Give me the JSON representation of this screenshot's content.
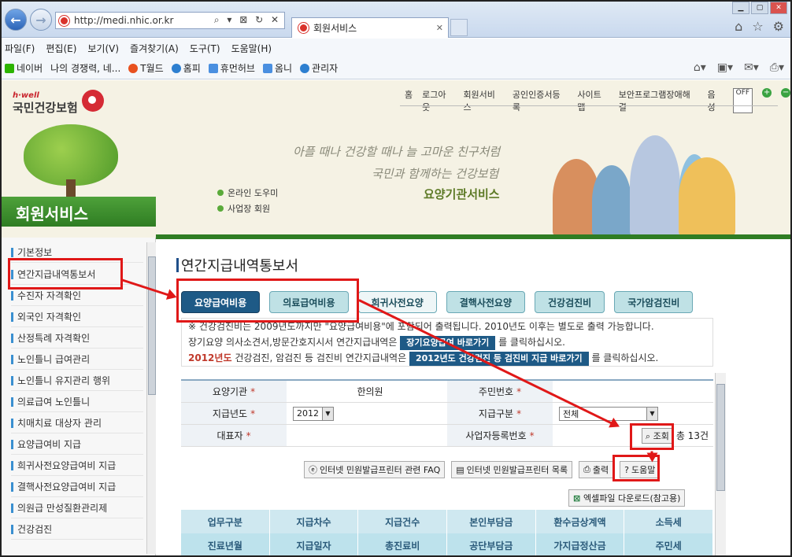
{
  "browser": {
    "url": "http://medi.nhic.or.kr",
    "tab_title": "회원서비스",
    "menu": [
      "파일(F)",
      "편집(E)",
      "보기(V)",
      "즐겨찾기(A)",
      "도구(T)",
      "도움말(H)"
    ],
    "favorites": [
      "네이버",
      "나의 경쟁력, 네...",
      "T월드",
      "홈피",
      "휴먼허브",
      "옴니",
      "관리자"
    ]
  },
  "site": {
    "logo_top": "h·well",
    "logo_name": "국민건강보험",
    "top_nav": [
      "홈",
      "로그아웃",
      "회원서비스",
      "공인인증서등록",
      "사이트맵",
      "보안프로그램장애해결",
      "음성"
    ],
    "sound_state": "OFF",
    "slogan_line1": "아플 때나 건강할 때나 늘 고마운 친구처럼",
    "slogan_line2": "국민과 함께하는 건강보험",
    "slogan_service": "요양기관서비스",
    "quicklinks": [
      "온라인 도우미",
      "사업장 회원"
    ],
    "section_title": "회원서비스"
  },
  "sidebar": {
    "items": [
      "기본정보",
      "연간지급내역통보서",
      "수진자 자격확인",
      "외국인 자격확인",
      "산정특례 자격확인",
      "노인틀니 급여관리",
      "노인틀니 유지관리 행위",
      "의료급여 노인틀니",
      "치매치료 대상자 관리",
      "요양급여비 지급",
      "희귀사전요양급여비 지급",
      "결핵사전요양급여비 지급",
      "의원급 만성질환관리제",
      "건강검진"
    ]
  },
  "main": {
    "page_title": "연간지급내역통보서",
    "tabs": [
      "요양급여비용",
      "의료급여비용",
      "희귀사전요양",
      "결핵사전요양",
      "건강검진비",
      "국가암검진비"
    ],
    "notice_line1": "※ 건강검진비는 2009년도까지만 \"요양급여비용\"에 포함되어 출력됩니다. 2010년도 이후는 별도로 출력 가능합니다.",
    "notice_line2_pre": "장기요양 의사소견서,방문간호지시서 연간지급내역은",
    "notice_btn1": "장기요양급여 바로가기",
    "notice_line2_post": "를 클릭하십시오.",
    "notice_year": "2012년도",
    "notice_line3_pre": "건강검진, 암검진 등 검진비 연간지급내역은",
    "notice_btn2": "2012년도 건강검진 등 검진비 지급 바로가기",
    "notice_line3_post": "를 클릭하십시오.",
    "form": {
      "institution_label": "요양기관",
      "institution_value": "한의원",
      "regno_label": "주민번호",
      "year_label": "지급년도",
      "year_value": "2012",
      "type_label": "지급구분",
      "type_value": "전체",
      "rep_label": "대표자",
      "bizno_label": "사업자등록번호",
      "search_label": "조회",
      "total_count": "총 13건"
    },
    "tools": [
      "인터넷 민원발급프린터 관련 FAQ",
      "인터넷 민원발급프린터 목록",
      "출력",
      "도움말"
    ],
    "excel_label": "엑셀파일 다운로드(참고용)",
    "grid_head1": [
      "업무구분",
      "지급차수",
      "지급건수",
      "본인부담금",
      "환수금상계액",
      "소득세"
    ],
    "grid_head2": [
      "진료년월",
      "지급일자",
      "총진료비",
      "공단부담금",
      "가지급정산금",
      "주민세"
    ]
  },
  "colors": {
    "accent_green": "#2f7d23",
    "tab_active": "#1e5a86",
    "annotation_red": "#e01818"
  }
}
